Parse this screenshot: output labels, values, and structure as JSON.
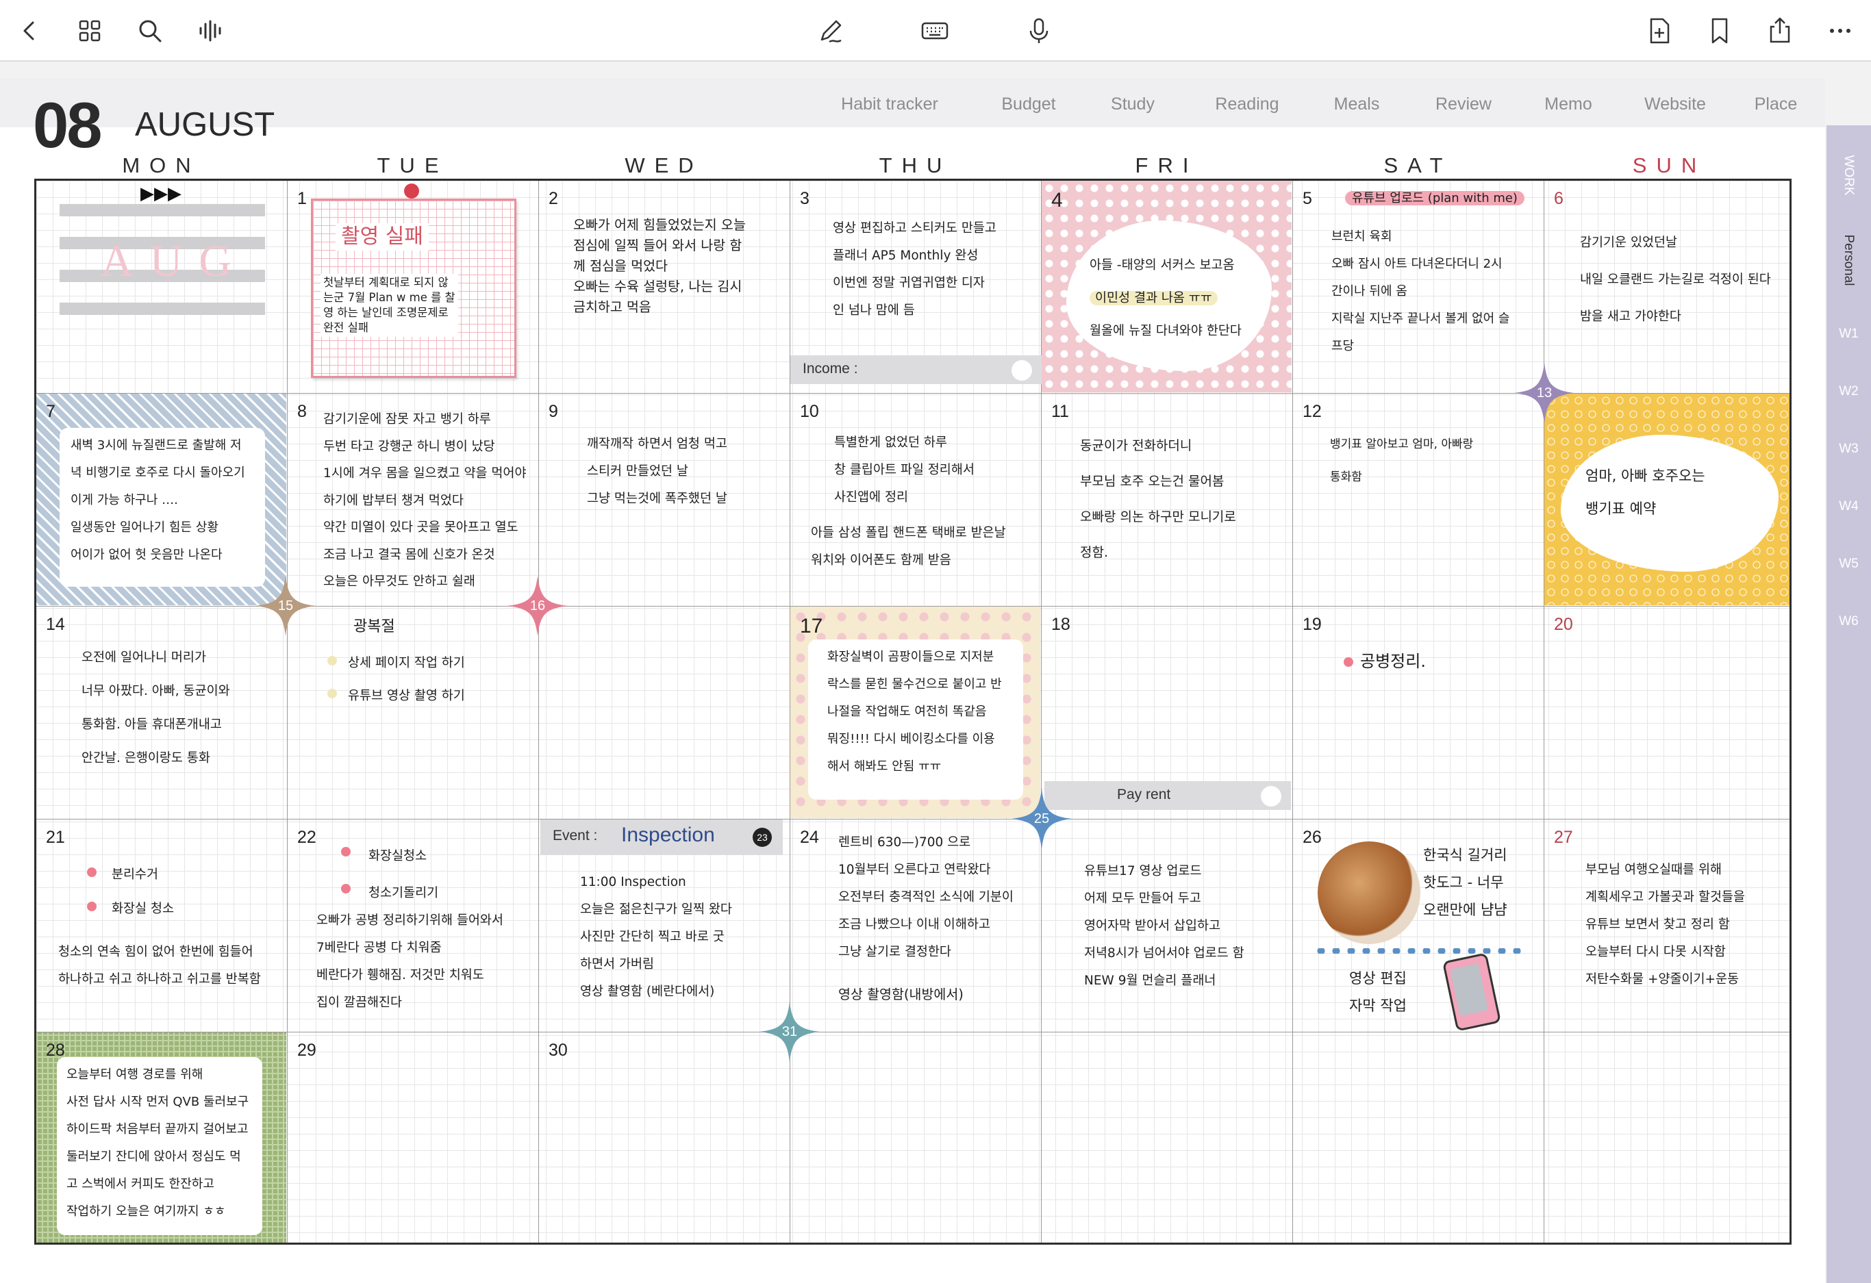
{
  "toolbar": {
    "left_icons": [
      "back-icon",
      "grid-icon",
      "search-icon",
      "audio-icon"
    ],
    "center_icons": [
      "pen-icon",
      "keyboard-icon",
      "microphone-icon"
    ],
    "right_icons": [
      "add-page-icon",
      "bookmark-icon",
      "share-icon",
      "more-icon"
    ]
  },
  "header": {
    "month_num": "08",
    "month_name": "AUGUST",
    "tabs": [
      "Habit tracker",
      "Budget",
      "Study",
      "Reading",
      "Meals",
      "Review",
      "Memo",
      "Website",
      "Place"
    ]
  },
  "weekdays": [
    "MON",
    "TUE",
    "WED",
    "THU",
    "FRI",
    "SAT",
    "SUN"
  ],
  "side_tabs": {
    "work": "WORK",
    "personal": "Personal",
    "weeks": [
      "W1",
      "W2",
      "W3",
      "W4",
      "W5",
      "W6"
    ]
  },
  "cells": {
    "aug_label": "AUG",
    "d1": {
      "day": "1",
      "title": "촬영 실패",
      "lines": [
        "첫날부터 계획대로 되지 않",
        "는군 7월 Plan w me 를 찰",
        "영 하는 날인데 조명문제로",
        "완전 실패"
      ]
    },
    "d2": {
      "day": "2",
      "lines": [
        "오빠가 어제 힘들었었는지 오늘",
        "점심에 일찍 들어 와서 나랑 함",
        "께 점심을 먹었다",
        "오빠는 수육 설렁탕, 나는 김시",
        "금치하고 먹음"
      ]
    },
    "d3": {
      "day": "3",
      "lines": [
        "영상 편집하고 스티커도 만들고",
        "플래너 AP5 Monthly  완성",
        "이번엔 정말 귀엽귀엽한 디자",
        "인 넘나 맘에 듬"
      ],
      "income_label": "Income :"
    },
    "d4": {
      "day": "4",
      "lines": [
        "아들 -태양의 서커스 보고옴",
        "이민성 결과 나옴 ㅠㅠ",
        "월올에 뉴질 다녀와야 한단다"
      ]
    },
    "d5": {
      "day": "5",
      "tag": "유튜브 업로드 (plan with me)",
      "lines": [
        "브런치 육회",
        "오빠 잠시 아트 다녀온다더니 2시",
        "간이나 뒤에 옴",
        "지락실 지난주 끝나서 볼게 없어 슬",
        "프당"
      ]
    },
    "d6": {
      "day": "6",
      "lines": [
        "감기기운 있었던날",
        "내일 오클랜드 가는길로 걱정이 된다",
        "밤을 새고 가야한다"
      ]
    },
    "d7": {
      "day": "7",
      "lines": [
        "새벽 3시에 뉴질랜드로 출발해 저",
        "녁 비행기로 호주로 다시 돌아오기",
        "이게 가능 하구나 ….",
        "일생동안 일어나기 힘든 상황",
        "어이가 없어 헛 웃음만 나온다"
      ]
    },
    "d8": {
      "day": "8",
      "lines": [
        "감기기운에 잠못 자고 뱅기 하루",
        "두번 타고 강행군 하니 병이 났당",
        "1시에 겨우 몸을 일으켰고 약을 먹어야",
        "하기에 밥부터 챙겨 먹었다",
        "약간 미열이 있다 곳을 못아프고 열도",
        "조금 나고 결국 몸에 신호가 온것",
        "오늘은 아무것도 안하고 쉴래"
      ]
    },
    "d9": {
      "day": "9",
      "lines": [
        "깨작깨작 하면서 엄청 먹고",
        "스티커 만들었던 날",
        "그냥 먹는것에 폭주했던 날"
      ]
    },
    "d10": {
      "day": "10",
      "lines": [
        "특별한게 없었던 하루",
        "창 클립아트 파일 정리해서",
        "사진앱에 정리",
        "아들 삼성 폴립 핸드폰 택배로 받은날",
        "워치와 이어폰도 함께 받음"
      ]
    },
    "d11": {
      "day": "11",
      "lines": [
        "동균이가  전화하더니",
        "부모님 호주  오는건  물어봄",
        "오빠랑 의논 하구만  모니기로",
        "  정함."
      ]
    },
    "d12": {
      "day": "12",
      "lines": [
        "뱅기표  알아보고  엄마, 아빠랑",
        "통화함"
      ]
    },
    "d13": {
      "day": "13",
      "lines": [
        "엄마, 아빠 호주오는",
        "뱅기표 예약"
      ]
    },
    "d14": {
      "day": "14",
      "lines": [
        "오전에  일어나니  머리가",
        "너무 아팠다.  아빠, 동균이와",
        "통화함.  아들  휴대폰개내고",
        " 안간날.       은행이랑도 통화"
      ]
    },
    "d15": {
      "day": "15",
      "title": "광복절",
      "lines": [
        "상세 페이지  작업 하기",
        "유튜브  영상  촬영 하기"
      ]
    },
    "d16": {
      "day": "16"
    },
    "d17": {
      "day": "17",
      "lines": [
        "화장실벽이 곰팡이들으로 지저분",
        "락스를 묻힌 물수건으로 붙이고 반",
        "나절을 작업해도 여전히 똑같음",
        "뭐징!!!! 다시 베이킹소다를 이용",
        "해서 해봐도 안됨 ㅠㅠ"
      ]
    },
    "d18": {
      "day": "18",
      "payrent_label": "Pay rent"
    },
    "d19": {
      "day": "19",
      "lines": [
        "공병정리."
      ]
    },
    "d20": {
      "day": "20"
    },
    "d21": {
      "day": "21",
      "bullets": [
        "분리수거",
        "화장실 청소"
      ],
      "lines": [
        "청소의 연속 힘이 없어 한번에 힘들어",
        "하나하고 쉬고 하나하고 쉬고를 반복함"
      ]
    },
    "d22": {
      "day": "22",
      "bullets": [
        "화장실청소",
        "청소기돌리기"
      ],
      "lines": [
        "오빠가 공병 정리하기위해 들어와서",
        "7베란다 공병 다 치워줌",
        "베란다가 휑해짐. 저것만 치워도",
        "집이 깔끔해진다"
      ]
    },
    "d23": {
      "day": "23",
      "event_label": "Event :",
      "event_value": "Inspection",
      "lines": [
        "11:00  Inspection",
        "오늘은 젊은친구가 일찍 왔다",
        "사진만 간단히 찍고 바로 굿",
        "하면서 가버림",
        "영상 촬영함 (베란다에서)"
      ]
    },
    "d24": {
      "day": "24",
      "lines": [
        "렌트비 630—)700 으로",
        "10월부터 오른다고 연락왔다",
        "오전부터 충격적인 소식에 기분이",
        "조금 나빴으나 이내 이해하고",
        "그냥 살기로 결정한다",
        "영상 촬영함(내방에서)"
      ]
    },
    "d25": {
      "day": "25",
      "lines": [
        "유튜브17 영상 업로드",
        "어제 모두 만들어 두고",
        "영어자막 받아서 삽입하고",
        "저녁8시가 넘어서야 업로드 함",
        "NEW 9월 먼슬리 플래너"
      ]
    },
    "d26": {
      "day": "26",
      "lines": [
        "한국식  길거리",
        "핫도그 - 너무",
        "오랜만에 냠냠"
      ],
      "lines2": [
        "영상  편집",
        "자막 작업"
      ]
    },
    "d27": {
      "day": "27",
      "lines": [
        "부모님 여행오실때를 위해",
        "계획세우고 가볼곳과 할것들을",
        "유튜브 보면서 찾고 정리 함",
        "오늘부터 다시 다못 시작함",
        "저탄수화물 +양줄이기+운동"
      ]
    },
    "d28": {
      "day": "28",
      "lines": [
        "오늘부터 여행 경로를 위해",
        "사전 답사 시작 먼저 QVB 둘러보구",
        "하이드팍 처음부터 끝까지 걸어보고",
        "둘러보기 잔디에 앉아서 정심도 먹",
        "고 스벅에서 커피도 한잔하고",
        "작업하기 오늘은 여기까지 ㅎㅎ"
      ]
    },
    "d29": {
      "day": "29"
    },
    "d30": {
      "day": "30"
    },
    "d31": {
      "day": "31"
    }
  },
  "colors": {
    "accent_purple": "#c9c6dc",
    "star_tan": "#b89c80",
    "star_pink": "#e57d92",
    "star_purple": "#9a88b8",
    "star_blue": "#5b8fc4",
    "star_teal": "#6fa6ad",
    "sunday_red": "#c0404e"
  }
}
